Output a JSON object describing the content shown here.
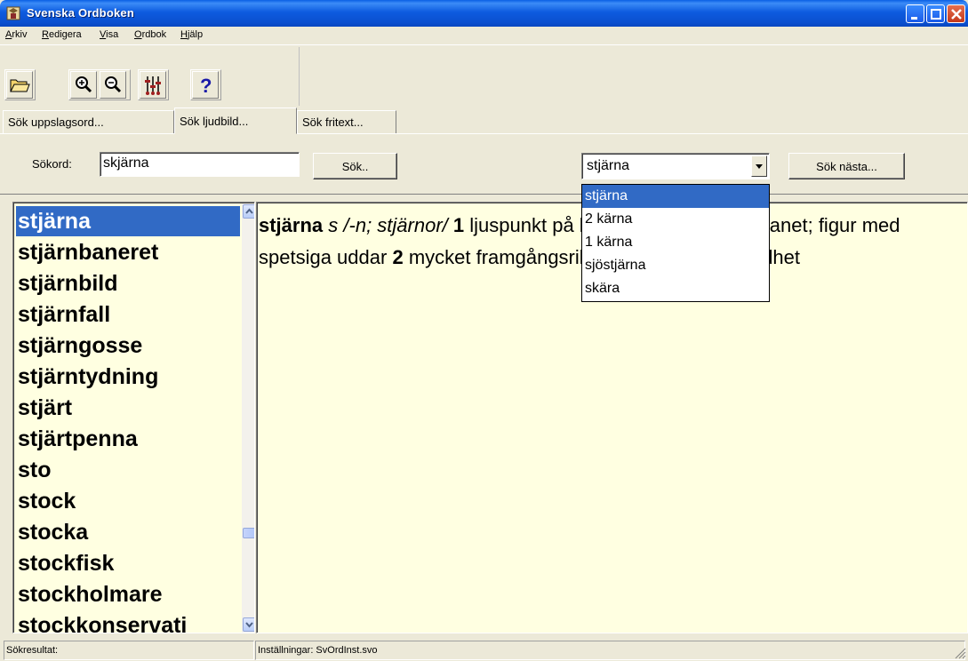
{
  "window": {
    "title": "Svenska Ordboken"
  },
  "menu": {
    "items": [
      {
        "label": "Arkiv",
        "accel": "A",
        "rest": "rkiv"
      },
      {
        "label": "Redigera",
        "accel": "R",
        "rest": "edigera"
      },
      {
        "label": "Visa",
        "accel": "V",
        "rest": "isa"
      },
      {
        "label": "Ordbok",
        "accel": "O",
        "rest": "rdbok"
      },
      {
        "label": "Hjälp",
        "accel": "H",
        "rest": "jälp"
      }
    ]
  },
  "toolbar": {
    "icons": [
      "open-folder-icon",
      "zoom-in-icon",
      "zoom-out-icon",
      "settings-sliders-icon",
      "help-icon"
    ]
  },
  "tabs": [
    {
      "label": "Sök uppslagsord...",
      "active": false
    },
    {
      "label": "Sök ljudbild...",
      "active": true
    },
    {
      "label": "Sök fritext...",
      "active": false
    }
  ],
  "search": {
    "label": "Sökord:",
    "value": "skjärna",
    "button": "Sök..",
    "next_button": "Sök nästa..."
  },
  "combo": {
    "value": "stjärna",
    "options": [
      "stjärna",
      "2 kärna",
      "1 kärna",
      "sjöstjärna",
      "skära"
    ],
    "selected_index": 0
  },
  "wordlist": {
    "items": [
      "stjärna",
      "stjärnbaneret",
      "stjärnbild",
      "stjärnfall",
      "stjärngosse",
      "stjärntydning",
      "stjärt",
      "stjärtpenna",
      "sto",
      "stock",
      "stocka",
      "stockfisk",
      "stockholmare",
      "stockkonservati"
    ],
    "selected_index": 0
  },
  "entry": {
    "headword": "stjärna",
    "grammar": "s /-n; stjärnor/",
    "sense1_num": "1",
    "sense1_text": "ljuspunkt på himlen; himlakropp, planet; figur med spetsiga uddar",
    "sense2_num": "2",
    "sense2_text": "mycket framgångsrik person, ess, berömdhet"
  },
  "status": {
    "left": "Sökresultat:",
    "right": "Inställningar: SvOrdInst.svo"
  },
  "colors": {
    "titlebar": "#0A5FE4",
    "selection": "#316AC5",
    "panel_bg": "#FFFFE1",
    "chrome": "#ECE9D8"
  }
}
